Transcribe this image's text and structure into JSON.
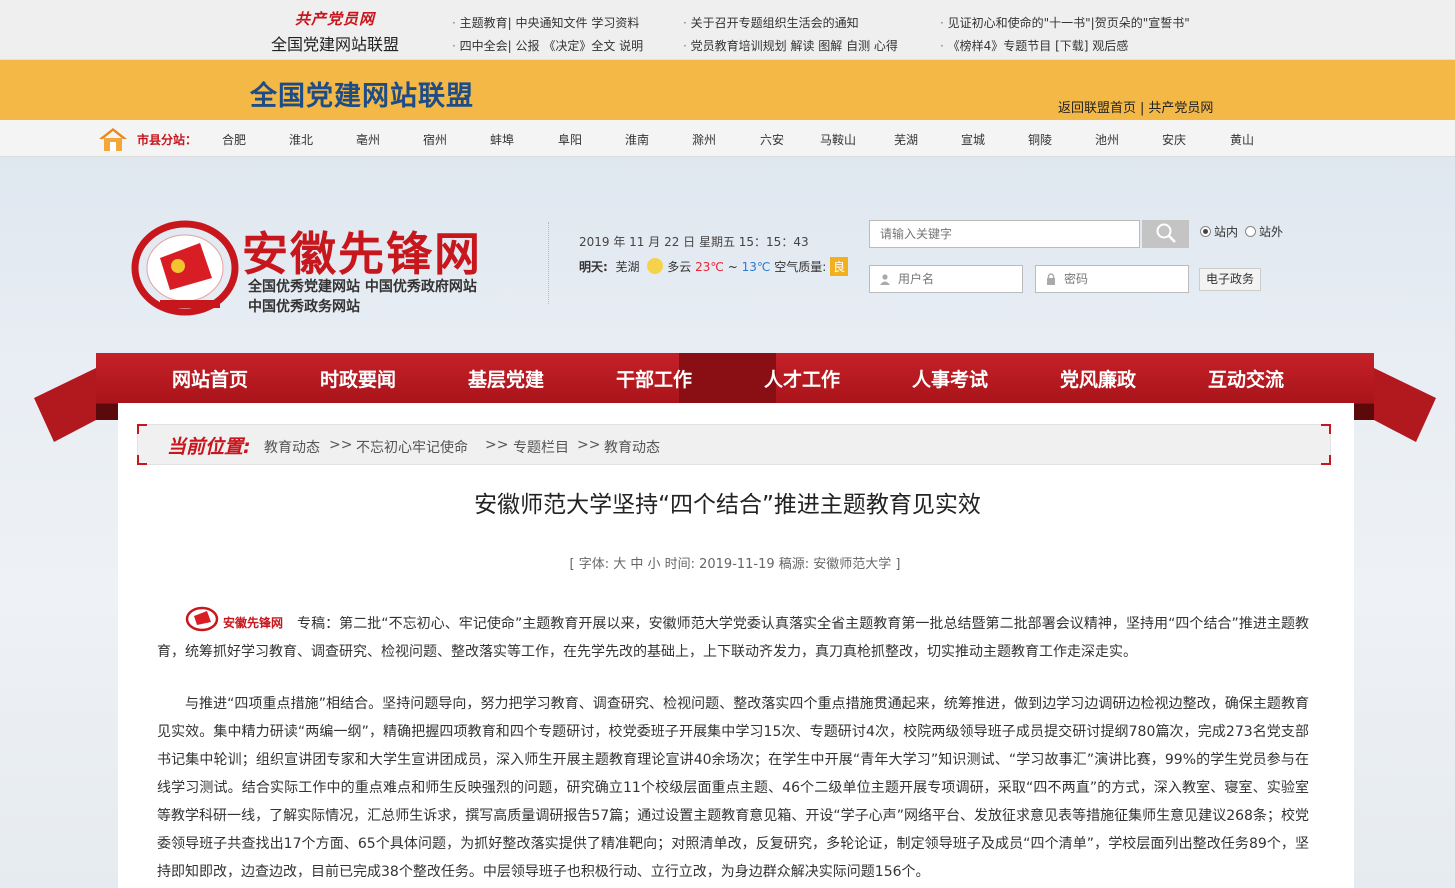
{
  "topbar": {
    "brand": "共产党员网",
    "alliance": "全国党建网站联盟",
    "links_col1": [
      "主题教育| 中央通知文件 学习资料",
      "四中全会| 公报 《决定》全文 说明"
    ],
    "links_col2": [
      "关于召开专题组织生活会的通知",
      "党员教育培训规划 解读 图解 自测 心得"
    ],
    "links_col3": [
      "见证初心和使命的\"十一书\"|贺页朵的\"宣誓书\"",
      "《榜样4》专题节目 [下载] 观后感"
    ]
  },
  "banner": {
    "title": "全国党建网站联盟",
    "link_home": "返回联盟首页",
    "link_sep": "|",
    "link_party": "共产党员网"
  },
  "citybar": {
    "label": "市县分站：",
    "cities": [
      "合肥",
      "淮北",
      "亳州",
      "宿州",
      "蚌埠",
      "阜阳",
      "淮南",
      "滁州",
      "六安",
      "马鞍山",
      "芜湖",
      "宣城",
      "铜陵",
      "池州",
      "安庆",
      "黄山"
    ]
  },
  "site": {
    "name": "安徽先锋网",
    "sub1": "全国优秀党建网站  中国优秀政府网站",
    "sub2": "中国优秀政务网站",
    "datetime": "2019 年 11 月 22 日 星期五 15：15：43",
    "weather_label": "明天:",
    "city": "芜湖",
    "condition": "多云",
    "temp_high": "23℃",
    "tilde": "~",
    "temp_low": "13℃",
    "aqi_label": "空气质量:",
    "aqi_value": "良"
  },
  "search": {
    "placeholder": "请输入关键字",
    "opt_in": "站内",
    "opt_out": "站外"
  },
  "login": {
    "user_placeholder": "用户名",
    "pass_placeholder": "密码",
    "egov": "电子政务"
  },
  "nav": [
    "网站首页",
    "时政要闻",
    "基层党建",
    "干部工作",
    "人才工作",
    "人事考试",
    "党风廉政",
    "互动交流"
  ],
  "breadcrumb": {
    "label": "当前位置:",
    "items": [
      "教育动态",
      "不忘初心牢记使命",
      "专题栏目",
      "教育动态"
    ],
    "sep": ">>"
  },
  "article": {
    "title": "安徽师范大学坚持“四个结合”推进主题教育见实效",
    "meta": "[ 字体: 大 中 小 时间: 2019-11-19 稿源: 安徽师范大学 ]",
    "logo_text": "安徽先锋网",
    "p1": "专稿：第二批“不忘初心、牢记使命”主题教育开展以来，安徽师范大学党委认真落实全省主题教育第一批总结暨第二批部署会议精神，坚持用“四个结合”推进主题教育，统筹抓好学习教育、调查研究、检视问题、整改落实等工作，在先学先改的基础上，上下联动齐发力，真刀真枪抓整改，切实推动主题教育工作走深走实。",
    "p2": "与推进“四项重点措施”相结合。坚持问题导向，努力把学习教育、调查研究、检视问题、整改落实四个重点措施贯通起来，统筹推进，做到边学习边调研边检视边整改，确保主题教育见实效。集中精力研读“两编一纲”，精确把握四项教育和四个专题研讨，校党委班子开展集中学习15次、专题研讨4次，校院两级领导班子成员提交研讨提纲780篇次，完成273名党支部书记集中轮训；组织宣讲团专家和大学生宣讲团成员，深入师生开展主题教育理论宣讲40余场次；在学生中开展“青年大学习”知识测试、“学习故事汇”演讲比赛，99%的学生党员参与在线学习测试。结合实际工作中的重点难点和师生反映强烈的问题，研究确立11个校级层面重点主题、46个二级单位主题开展专项调研，采取“四不两直”的方式，深入教室、寝室、实验室等教学科研一线，了解实际情况，汇总师生诉求，撰写高质量调研报告57篇；通过设置主题教育意见箱、开设“学子心声”网络平台、发放征求意见表等措施征集师生意见建议268条；校党委领导班子共查找出17个方面、65个具体问题，为抓好整改落实提供了精准靶向；对照清单改，反复研究，多轮论证，制定领导班子及成员“四个清单”，学校层面列出整改任务89个，坚持即知即改，边查边改，目前已完成38个整改任务。中层领导班子也积极行动、立行立改，为身边群众解决实际问题156个。"
  },
  "colors": {
    "red": "#c8161d",
    "orange": "#f4b847",
    "navy": "#1e4c86"
  }
}
